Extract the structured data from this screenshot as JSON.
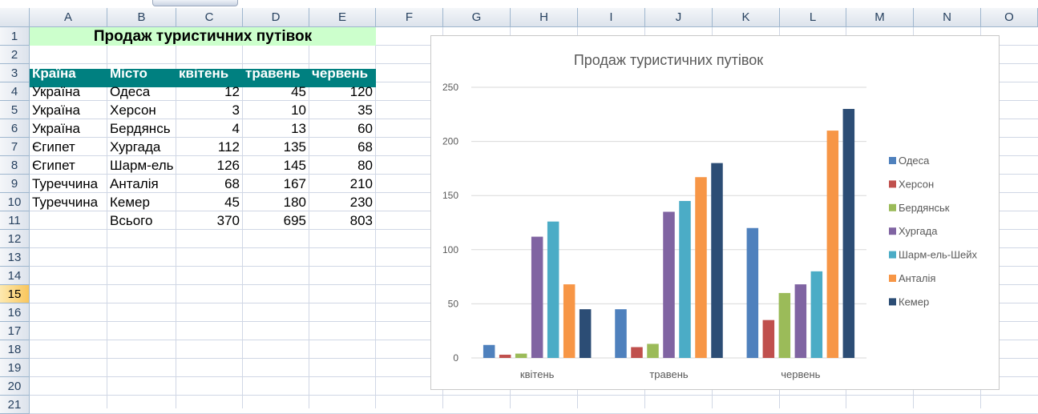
{
  "columns": [
    "A",
    "B",
    "C",
    "D",
    "E",
    "F",
    "G",
    "H",
    "I",
    "J",
    "K",
    "L",
    "M",
    "N",
    "O"
  ],
  "rows": [
    "1",
    "2",
    "3",
    "4",
    "5",
    "6",
    "7",
    "8",
    "9",
    "10",
    "11",
    "12",
    "13",
    "14",
    "15",
    "16",
    "17",
    "18",
    "19",
    "20",
    "21"
  ],
  "selected_row": "15",
  "sheet": {
    "title": "Продаж туристичних путівок",
    "headers": [
      "Країна",
      "Місто",
      "квітень",
      "травень",
      "червень"
    ],
    "data": [
      [
        "Україна",
        "Одеса",
        "12",
        "45",
        "120"
      ],
      [
        "Україна",
        "Херсон",
        "3",
        "10",
        "35"
      ],
      [
        "Україна",
        "Бердянсь",
        "4",
        "13",
        "60"
      ],
      [
        "Єгипет",
        "Хургада",
        "112",
        "135",
        "68"
      ],
      [
        "Єгипет",
        "Шарм-ель",
        "126",
        "145",
        "80"
      ],
      [
        "Туреччина",
        "Анталія",
        "68",
        "167",
        "210"
      ],
      [
        "Туреччина",
        "Кемер",
        "45",
        "180",
        "230"
      ],
      [
        "",
        "Всього",
        "370",
        "695",
        "803"
      ]
    ]
  },
  "chart_data": {
    "type": "bar",
    "title": "Продаж туристичних путівок",
    "categories": [
      "квітень",
      "травень",
      "червень"
    ],
    "series": [
      {
        "name": "Одеса",
        "values": [
          12,
          45,
          120
        ],
        "color": "#4f81bd"
      },
      {
        "name": "Херсон",
        "values": [
          3,
          10,
          35
        ],
        "color": "#c0504d"
      },
      {
        "name": "Бердянськ",
        "values": [
          4,
          13,
          60
        ],
        "color": "#9bbb59"
      },
      {
        "name": "Хургада",
        "values": [
          112,
          135,
          68
        ],
        "color": "#8064a2"
      },
      {
        "name": "Шарм-ель-Шейх",
        "values": [
          126,
          145,
          80
        ],
        "color": "#4bacc6"
      },
      {
        "name": "Анталія",
        "values": [
          68,
          167,
          210
        ],
        "color": "#f79646"
      },
      {
        "name": "Кемер",
        "values": [
          45,
          180,
          230
        ],
        "color": "#2c4d75"
      }
    ],
    "yticks": [
      "0",
      "50",
      "100",
      "150",
      "200",
      "250"
    ],
    "ylim": [
      0,
      250
    ],
    "grid": true,
    "legend": "right"
  }
}
